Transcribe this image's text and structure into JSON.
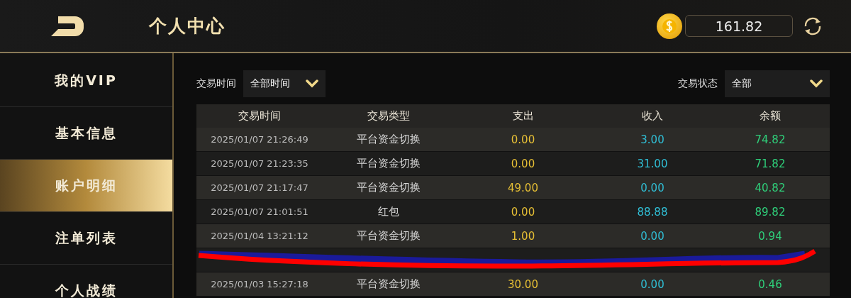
{
  "header": {
    "title": "个人中心",
    "balance": "161.82"
  },
  "sidebar": {
    "items": [
      {
        "label": "我的VIP",
        "selected": false
      },
      {
        "label": "基本信息",
        "selected": false
      },
      {
        "label": "账户明细",
        "selected": true
      },
      {
        "label": "注单列表",
        "selected": false
      },
      {
        "label": "个人战绩",
        "selected": false
      }
    ]
  },
  "filters": [
    {
      "label": "交易时间",
      "value": "全部时间"
    },
    {
      "label": "交易状态",
      "value": "全部"
    }
  ],
  "table": {
    "columns": [
      "交易时间",
      "交易类型",
      "支出",
      "收入",
      "余额"
    ],
    "rows": [
      {
        "kind": "record",
        "time": "2025/01/07 21:26:49",
        "type": "平台资金切换",
        "expense": "0.00",
        "income": "3.00",
        "balance": "74.82"
      },
      {
        "kind": "record",
        "time": "2025/01/07 21:23:35",
        "type": "平台资金切换",
        "expense": "0.00",
        "income": "31.00",
        "balance": "71.82"
      },
      {
        "kind": "record",
        "time": "2025/01/07 21:17:47",
        "type": "平台资金切换",
        "expense": "49.00",
        "income": "0.00",
        "balance": "40.82"
      },
      {
        "kind": "record",
        "time": "2025/01/07 21:01:51",
        "type": "红包",
        "expense": "0.00",
        "income": "88.88",
        "balance": "89.82"
      },
      {
        "kind": "record",
        "time": "2025/01/04 13:21:12",
        "type": "平台资金切换",
        "expense": "1.00",
        "income": "0.00",
        "balance": "0.94"
      },
      {
        "kind": "obscured"
      },
      {
        "kind": "record",
        "time": "2025/01/03 15:27:18",
        "type": "平台资金切换",
        "expense": "30.00",
        "income": "0.00",
        "balance": "0.46"
      }
    ]
  }
}
